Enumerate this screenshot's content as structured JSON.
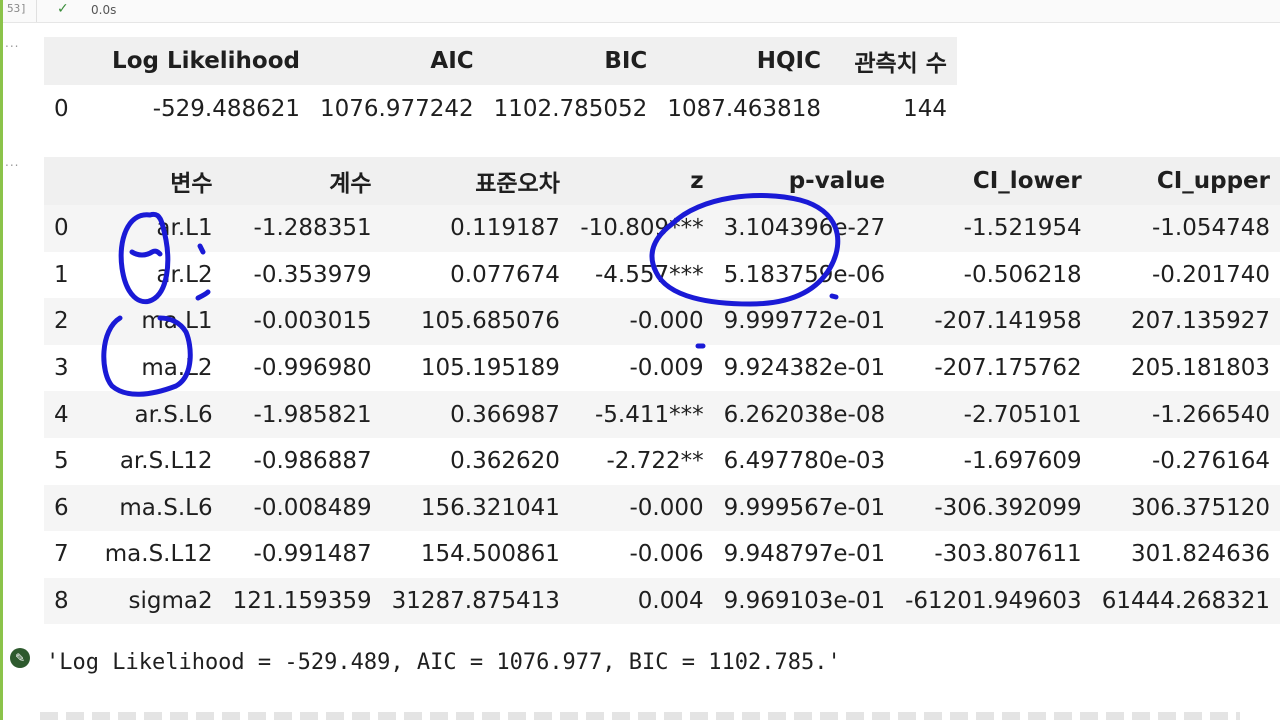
{
  "cell": {
    "exec_count": "53]",
    "exec_time": "0.0s",
    "ellipsis": "..."
  },
  "table1": {
    "columns": [
      "",
      "Log Likelihood",
      "AIC",
      "BIC",
      "HQIC",
      "관측치 수"
    ],
    "rows": [
      [
        "0",
        "-529.488621",
        "1076.977242",
        "1102.785052",
        "1087.463818",
        "144"
      ]
    ]
  },
  "table2": {
    "columns": [
      "",
      "변수",
      "계수",
      "표준오차",
      "z",
      "p-value",
      "CI_lower",
      "CI_upper"
    ],
    "rows": [
      [
        "0",
        "ar.L1",
        "-1.288351",
        "0.119187",
        "-10.809***",
        "3.104396e-27",
        "-1.521954",
        "-1.054748"
      ],
      [
        "1",
        "ar.L2",
        "-0.353979",
        "0.077674",
        "-4.557***",
        "5.183759e-06",
        "-0.506218",
        "-0.201740"
      ],
      [
        "2",
        "ma.L1",
        "-0.003015",
        "105.685076",
        "-0.000",
        "9.999772e-01",
        "-207.141958",
        "207.135927"
      ],
      [
        "3",
        "ma.L2",
        "-0.996980",
        "105.195189",
        "-0.009",
        "9.924382e-01",
        "-207.175762",
        "205.181803"
      ],
      [
        "4",
        "ar.S.L6",
        "-1.985821",
        "0.366987",
        "-5.411***",
        "6.262038e-08",
        "-2.705101",
        "-1.266540"
      ],
      [
        "5",
        "ar.S.L12",
        "-0.986887",
        "0.362620",
        "-2.722**",
        "6.497780e-03",
        "-1.697609",
        "-0.276164"
      ],
      [
        "6",
        "ma.S.L6",
        "-0.008489",
        "156.321041",
        "-0.000",
        "9.999567e-01",
        "-306.392099",
        "306.375120"
      ],
      [
        "7",
        "ma.S.L12",
        "-0.991487",
        "154.500861",
        "-0.006",
        "9.948797e-01",
        "-303.807611",
        "301.824636"
      ],
      [
        "8",
        "sigma2",
        "121.159359",
        "31287.875413",
        "0.004",
        "9.969103e-01",
        "-61201.949603",
        "61444.268321"
      ]
    ]
  },
  "output_string": "'Log Likelihood = -529.489, AIC = 1076.977, BIC = 1102.785.'",
  "colors": {
    "cell_accent": "#8bc34a",
    "annotation_ink": "#1a1ad6",
    "header_bg": "#f0f0f0",
    "stripe_bg": "#f5f5f5"
  },
  "icons": [
    "check-icon",
    "output-icon"
  ]
}
